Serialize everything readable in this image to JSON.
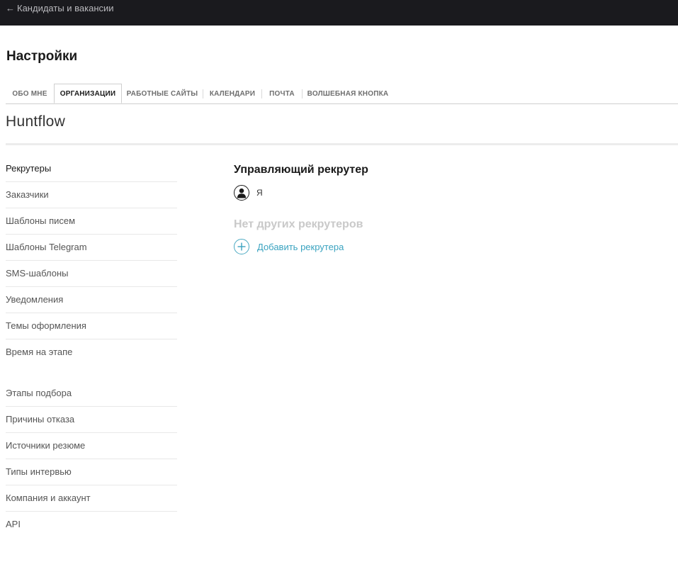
{
  "header": {
    "back_arrow": "←",
    "back_label": "Кандидаты и вакансии"
  },
  "page": {
    "title": "Настройки"
  },
  "tabs": [
    {
      "label": "Обо мне",
      "active": false
    },
    {
      "label": "Организации",
      "active": true
    },
    {
      "label": "Работные сайты",
      "active": false
    },
    {
      "label": "Календари",
      "active": false
    },
    {
      "label": "Почта",
      "active": false
    },
    {
      "label": "Волшебная кнопка",
      "active": false
    }
  ],
  "organization": {
    "name": "Huntflow"
  },
  "sidebar": {
    "group1": [
      {
        "label": "Рекрутеры",
        "active": true
      },
      {
        "label": "Заказчики"
      },
      {
        "label": "Шаблоны писем"
      },
      {
        "label": "Шаблоны Telegram"
      },
      {
        "label": "SMS-шаблоны"
      },
      {
        "label": "Уведомления"
      },
      {
        "label": "Темы оформления"
      },
      {
        "label": "Время на этапе"
      }
    ],
    "group2": [
      {
        "label": "Этапы подбора"
      },
      {
        "label": "Причины отказа"
      },
      {
        "label": "Источники резюме"
      },
      {
        "label": "Типы интервью"
      },
      {
        "label": "Компания и аккаунт"
      },
      {
        "label": "API"
      }
    ]
  },
  "main": {
    "section_title": "Управляющий рекрутер",
    "manager": {
      "name": "Я",
      "icon": "user-avatar-icon"
    },
    "no_others_label": "Нет других рекрутеров",
    "add_label": "Добавить рекрутера",
    "add_icon": "plus-circle-icon"
  },
  "colors": {
    "topbar_bg": "#1a1a1e",
    "accent": "#3aa3c0",
    "muted": "#c9c9c9"
  }
}
